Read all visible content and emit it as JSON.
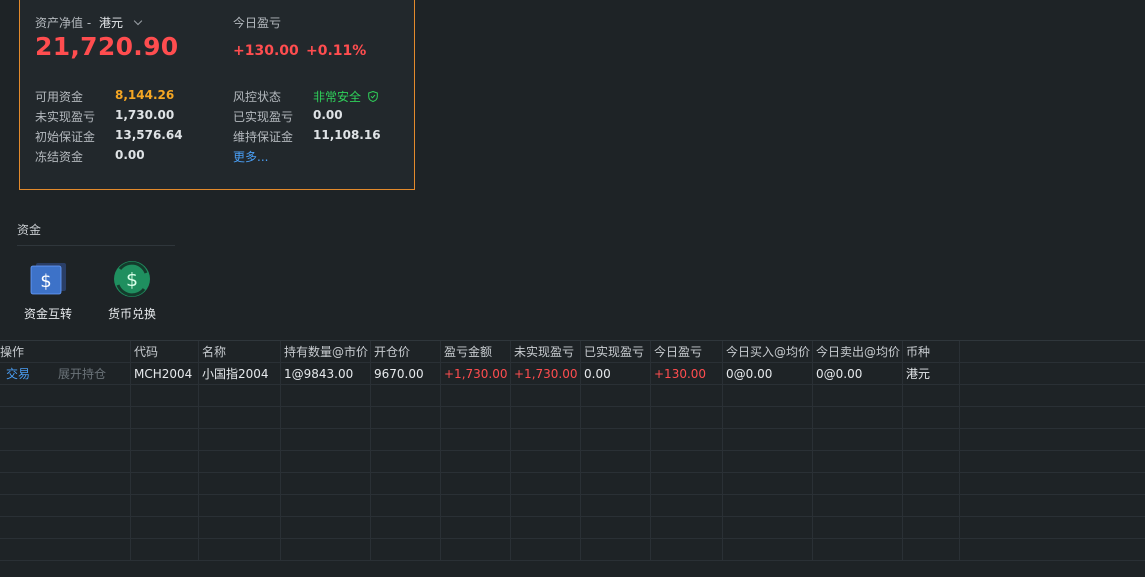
{
  "summary": {
    "net_asset_label": "资产净值 -",
    "currency": "港元",
    "net_asset_value": "21,720.90",
    "today_pl_label": "今日盈亏",
    "today_pl_amount": "+130.00",
    "today_pl_percent": "+0.11%",
    "left_items": [
      {
        "label": "可用资金",
        "value": "8,144.26"
      },
      {
        "label": "未实现盈亏",
        "value": "1,730.00"
      },
      {
        "label": "初始保证金",
        "value": "13,576.64"
      },
      {
        "label": "冻结资金",
        "value": "0.00"
      }
    ],
    "right_items": [
      {
        "label": "风控状态",
        "value": "非常安全"
      },
      {
        "label": "已实现盈亏",
        "value": "0.00"
      },
      {
        "label": "维持保证金",
        "value": "11,108.16"
      }
    ],
    "more_link": "更多..."
  },
  "funds": {
    "title": "资金",
    "tools": [
      {
        "label": "资金互转",
        "icon": "transfer-icon"
      },
      {
        "label": "货币兑换",
        "icon": "currency-exchange-icon"
      }
    ]
  },
  "table": {
    "headers": [
      "操作",
      "代码",
      "名称",
      "持有数量@市价",
      "开仓价",
      "盈亏金额",
      "未实现盈亏",
      "已实现盈亏",
      "今日盈亏",
      "今日买入@均价",
      "今日卖出@均价",
      "币种"
    ],
    "rows": [
      {
        "action_trade": "交易",
        "action_expand": "展开持仓",
        "code": "MCH2004",
        "name": "小国指2004",
        "qty_price": "1@9843.00",
        "open_price": "9670.00",
        "pl_amount": "+1,730.00",
        "unrealized": "+1,730.00",
        "realized": "0.00",
        "today_pl": "+130.00",
        "today_buy": "0@0.00",
        "today_sell": "0@0.00",
        "currency": "港元"
      }
    ]
  },
  "colors": {
    "accent_border": "#e38a2c",
    "loss_gain_red": "#ff4d4f",
    "safe_green": "#2fd05a",
    "link_blue": "#4a9ff5",
    "available_orange": "#f5a623"
  }
}
